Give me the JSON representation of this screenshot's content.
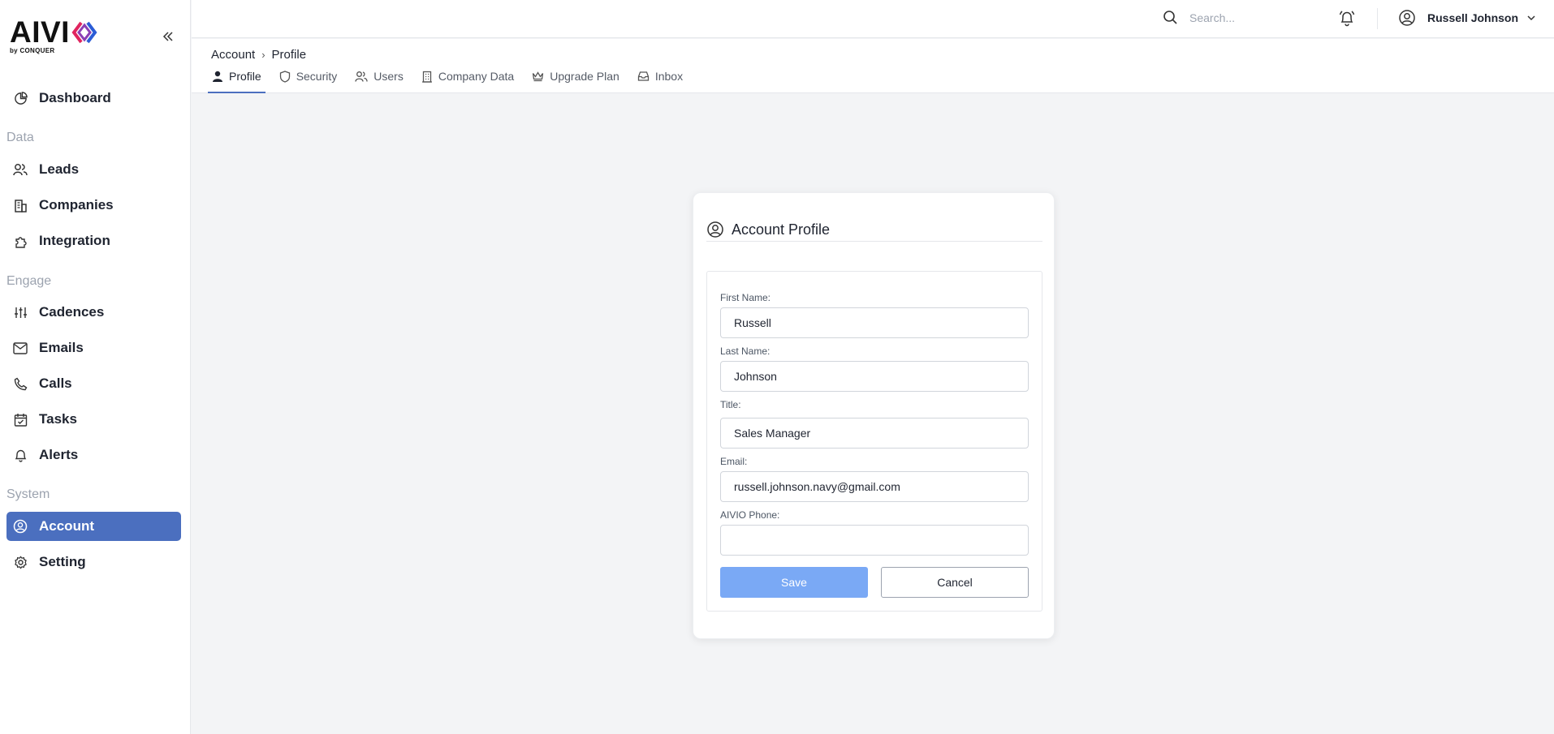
{
  "brand": {
    "logo_text": "AIVI",
    "logo_sub": "by CONQUER",
    "accent": "#4b6fbf"
  },
  "sidebar": {
    "collapse_icon": "double-chevron-left-icon",
    "items": [
      {
        "label": "Dashboard",
        "icon": "chart-pie-icon"
      },
      {
        "label": "Leads",
        "icon": "users-icon"
      },
      {
        "label": "Companies",
        "icon": "building-icon"
      },
      {
        "label": "Integration",
        "icon": "puzzle-icon"
      },
      {
        "label": "Cadences",
        "icon": "sliders-icon"
      },
      {
        "label": "Emails",
        "icon": "mail-icon"
      },
      {
        "label": "Calls",
        "icon": "phone-icon"
      },
      {
        "label": "Tasks",
        "icon": "calendar-check-icon"
      },
      {
        "label": "Alerts",
        "icon": "bell-icon"
      },
      {
        "label": "Account",
        "icon": "user-circle-icon",
        "active": true
      },
      {
        "label": "Setting",
        "icon": "gear-icon"
      }
    ],
    "sections": {
      "data": "Data",
      "engage": "Engage",
      "system": "System"
    }
  },
  "header": {
    "search_placeholder": "Search...",
    "user_name": "Russell Johnson"
  },
  "subheader": {
    "breadcrumb": [
      "Account",
      "Profile"
    ],
    "tabs": [
      {
        "label": "Profile",
        "active": true
      },
      {
        "label": "Security"
      },
      {
        "label": "Users"
      },
      {
        "label": "Company Data"
      },
      {
        "label": "Upgrade Plan"
      },
      {
        "label": "Inbox"
      }
    ]
  },
  "profile_card": {
    "title": "Account Profile",
    "fields": {
      "first_name": {
        "label": "First Name:",
        "value": "Russell"
      },
      "last_name": {
        "label": "Last Name:",
        "value": "Johnson"
      },
      "title": {
        "label": "Title:",
        "value": "Sales Manager"
      },
      "email": {
        "label": "Email:",
        "value": "russell.johnson.navy@gmail.com"
      },
      "phone": {
        "label": "AIVIO Phone:",
        "value": ""
      }
    },
    "save_label": "Save",
    "cancel_label": "Cancel"
  }
}
